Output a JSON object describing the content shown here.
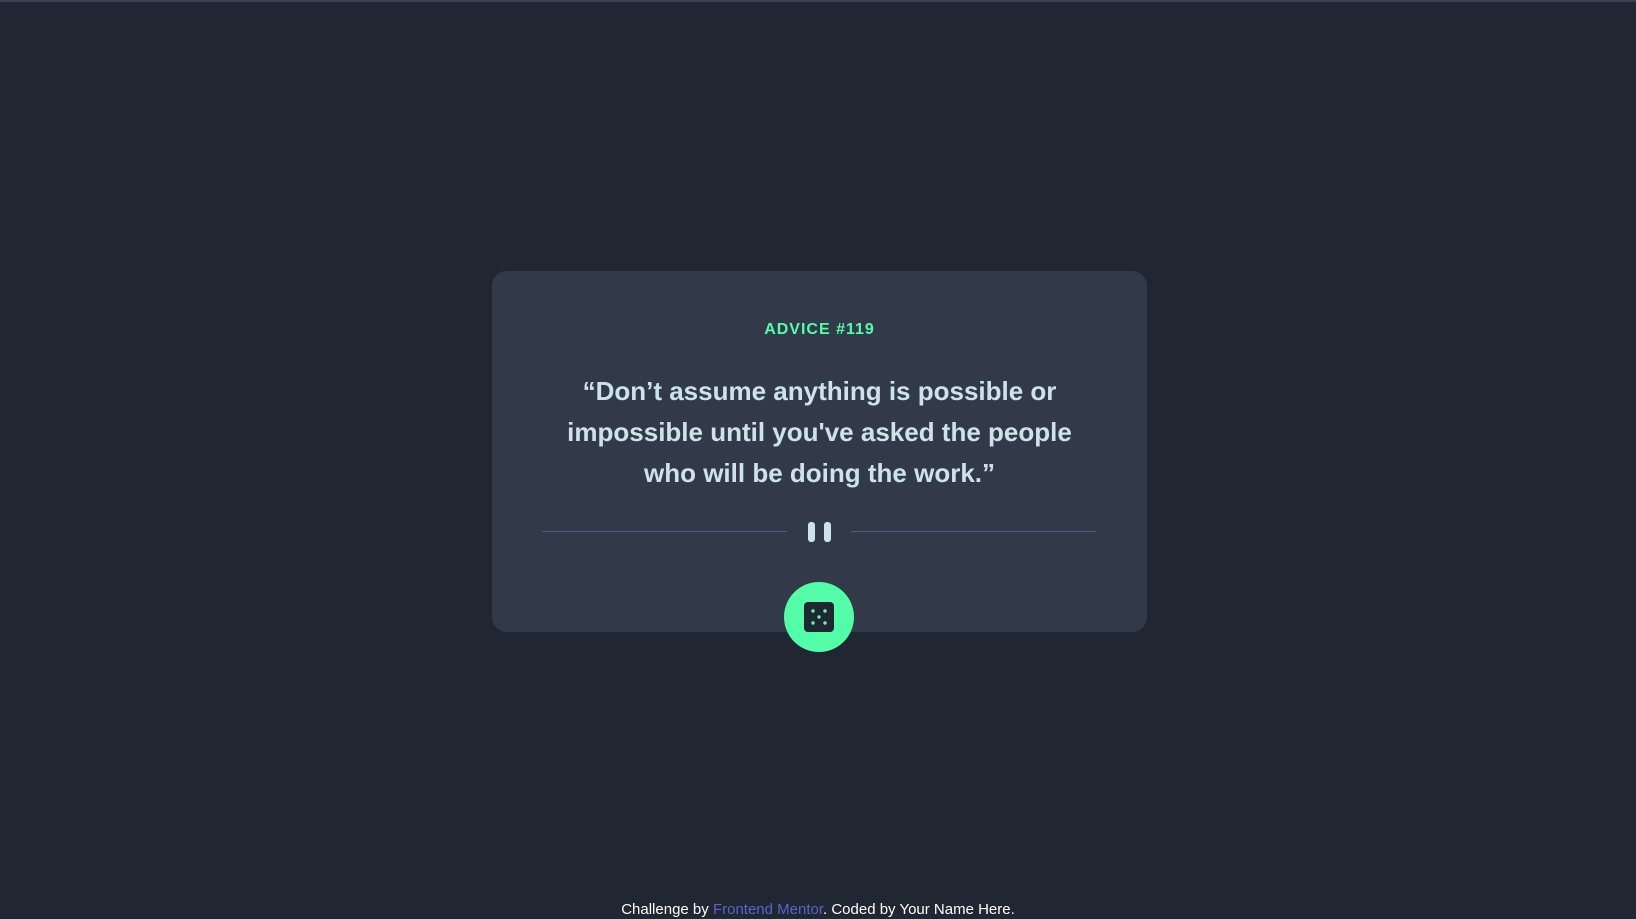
{
  "advice": {
    "label": "ADVICE #119",
    "quote": "“Don’t assume anything is possible or impossible until you've asked the people who will be doing the work.”"
  },
  "divider": {
    "icon": "pause-icon"
  },
  "dice_button": {
    "icon": "dice-icon"
  },
  "footer": {
    "prefix": "Challenge by ",
    "link_text": "Frontend Mentor",
    "suffix": ". Coded by Your Name Here."
  },
  "colors": {
    "background": "#202632",
    "card": "#323a49",
    "accent": "#52ffa8",
    "quote_text": "#cee3e9",
    "link": "#5b63c7"
  }
}
